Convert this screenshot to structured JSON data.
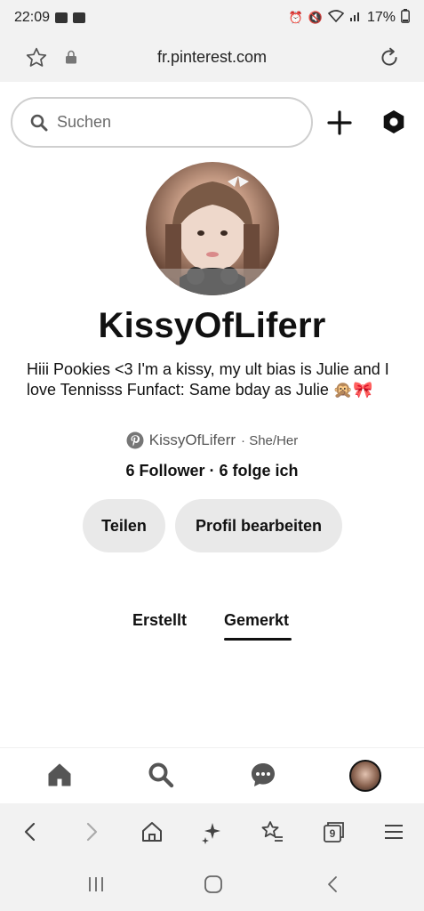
{
  "status_bar": {
    "time": "22:09",
    "battery": "17%"
  },
  "url_bar": {
    "url": "fr.pinterest.com"
  },
  "header": {
    "search_placeholder": "Suchen"
  },
  "profile": {
    "name": "KissyOfLiferr",
    "bio": "Hiii Pookies <3 I'm a kissy, my ult bias is Julie and I love Tennisss Funfact: Same bday as Julie 🙊🎀",
    "handle": "KissyOfLiferr",
    "pronouns": "· She/Her",
    "followers": "6 Follower",
    "following": "6 folge ich",
    "follow_sep": " · "
  },
  "buttons": {
    "share": "Teilen",
    "edit_profile": "Profil bearbeiten"
  },
  "tabs": {
    "created": "Erstellt",
    "saved": "Gemerkt"
  },
  "browser_toolbar": {
    "tab_count": "9"
  },
  "colors": {
    "accent": "#111111",
    "button_bg": "#e9e9e9",
    "pinterest_gray": "#767676"
  }
}
